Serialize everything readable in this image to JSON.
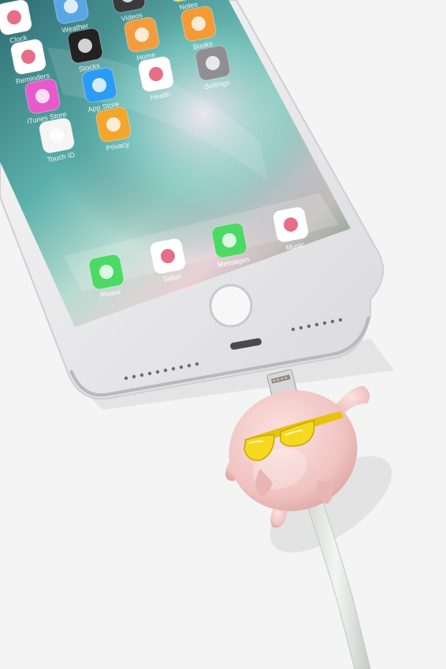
{
  "scene": {
    "background": "#f4f4f4",
    "phone_color": "#e9e9ea",
    "screen_colors": [
      "#2f7d74",
      "#6cc3b8",
      "#a7d3c9",
      "#e6d3d9",
      "#3b6d5a"
    ],
    "charm_color": "#f1c9c7",
    "sunglasses_color": "#f1d21a",
    "cable_color": "#e7ebe8"
  },
  "phone": {
    "apps": [
      {
        "label": "Clock",
        "icon": "clock-icon",
        "color": "#ffffff"
      },
      {
        "label": "Weather",
        "icon": "weather-icon",
        "color": "#5aa5e6"
      },
      {
        "label": "Videos",
        "icon": "clapper-icon",
        "color": "#3a3a3a"
      },
      {
        "label": "Notes",
        "icon": "notes-icon",
        "color": "#f7d34a"
      },
      {
        "label": "Reminders",
        "icon": "reminders-icon",
        "color": "#ffffff"
      },
      {
        "label": "Stocks",
        "icon": "stocks-icon",
        "color": "#222222"
      },
      {
        "label": "Home",
        "icon": "home-icon",
        "color": "#f39c3d"
      },
      {
        "label": "Books",
        "icon": "books-icon",
        "color": "#f39b35"
      },
      {
        "label": "iTunes Store",
        "icon": "itunes-icon",
        "color": "#e65bc9"
      },
      {
        "label": "App Store",
        "icon": "app-store-icon",
        "color": "#2b9cf5"
      },
      {
        "label": "Health",
        "icon": "heart-icon",
        "color": "#ffffff"
      },
      {
        "label": "Settings",
        "icon": "settings-icon",
        "color": "#8e8e93"
      },
      {
        "label": "Touch ID",
        "icon": "fingerprint-icon",
        "color": "#f5f5f5"
      },
      {
        "label": "Privacy",
        "icon": "hand-icon",
        "color": "#f4a52b"
      }
    ],
    "dock": [
      {
        "label": "Phone",
        "icon": "phone-icon",
        "color": "#4cd964"
      },
      {
        "label": "Safari",
        "icon": "compass-icon",
        "color": "#ffffff"
      },
      {
        "label": "Messages",
        "icon": "speech-bubble-icon",
        "color": "#4cd964"
      },
      {
        "label": "Music",
        "icon": "music-note-icon",
        "color": "#ffffff"
      }
    ]
  }
}
